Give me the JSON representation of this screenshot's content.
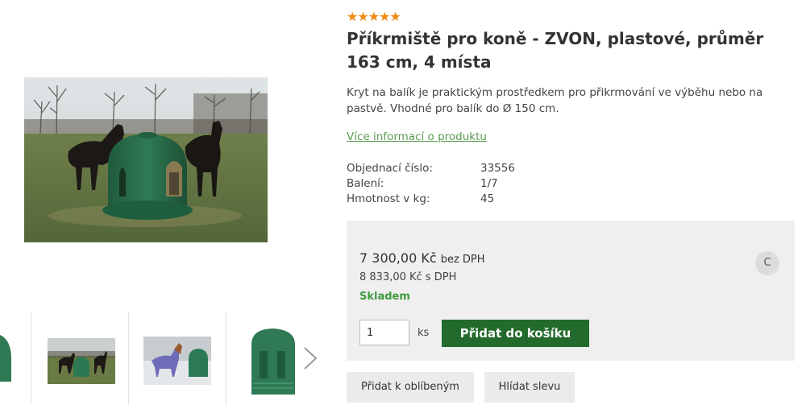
{
  "product": {
    "rating_stars": "★★★★★",
    "title": "Příkrmiště pro koně - ZVON, plastové, průměr 163 cm, 4 místa",
    "description": "Kryt na balík je praktickým prostředkem pro přikrmování ve výběhu nebo na pastvě. Vhodné pro balík do Ø 150 cm.",
    "more_info_link": "Více informací o produktu"
  },
  "specs": [
    {
      "label": "Objednací číslo:",
      "value": "33556"
    },
    {
      "label": "Balení:",
      "value": "1/7"
    },
    {
      "label": "Hmotnost v kg:",
      "value": "45"
    }
  ],
  "pricing": {
    "price_net": "7 300,00 Kč",
    "price_net_suffix": "bez DPH",
    "price_gross": "8 833,00 Kč s DPH",
    "stock_status": "Skladem",
    "badge": "C",
    "quantity_value": "1",
    "quantity_unit": "ks",
    "add_to_cart_label": "Přidat do košíku"
  },
  "actions": {
    "favorite_label": "Přidat k oblíbeným",
    "watch_price_label": "Hlídat slevu"
  },
  "gallery": {
    "next_arrow_icon": "chevron-right-icon"
  },
  "colors": {
    "star": "#f08a12",
    "link": "#5a9c50",
    "stock": "#3f9a3d",
    "cart_button": "#236b2c",
    "price_box": "#efefef"
  }
}
